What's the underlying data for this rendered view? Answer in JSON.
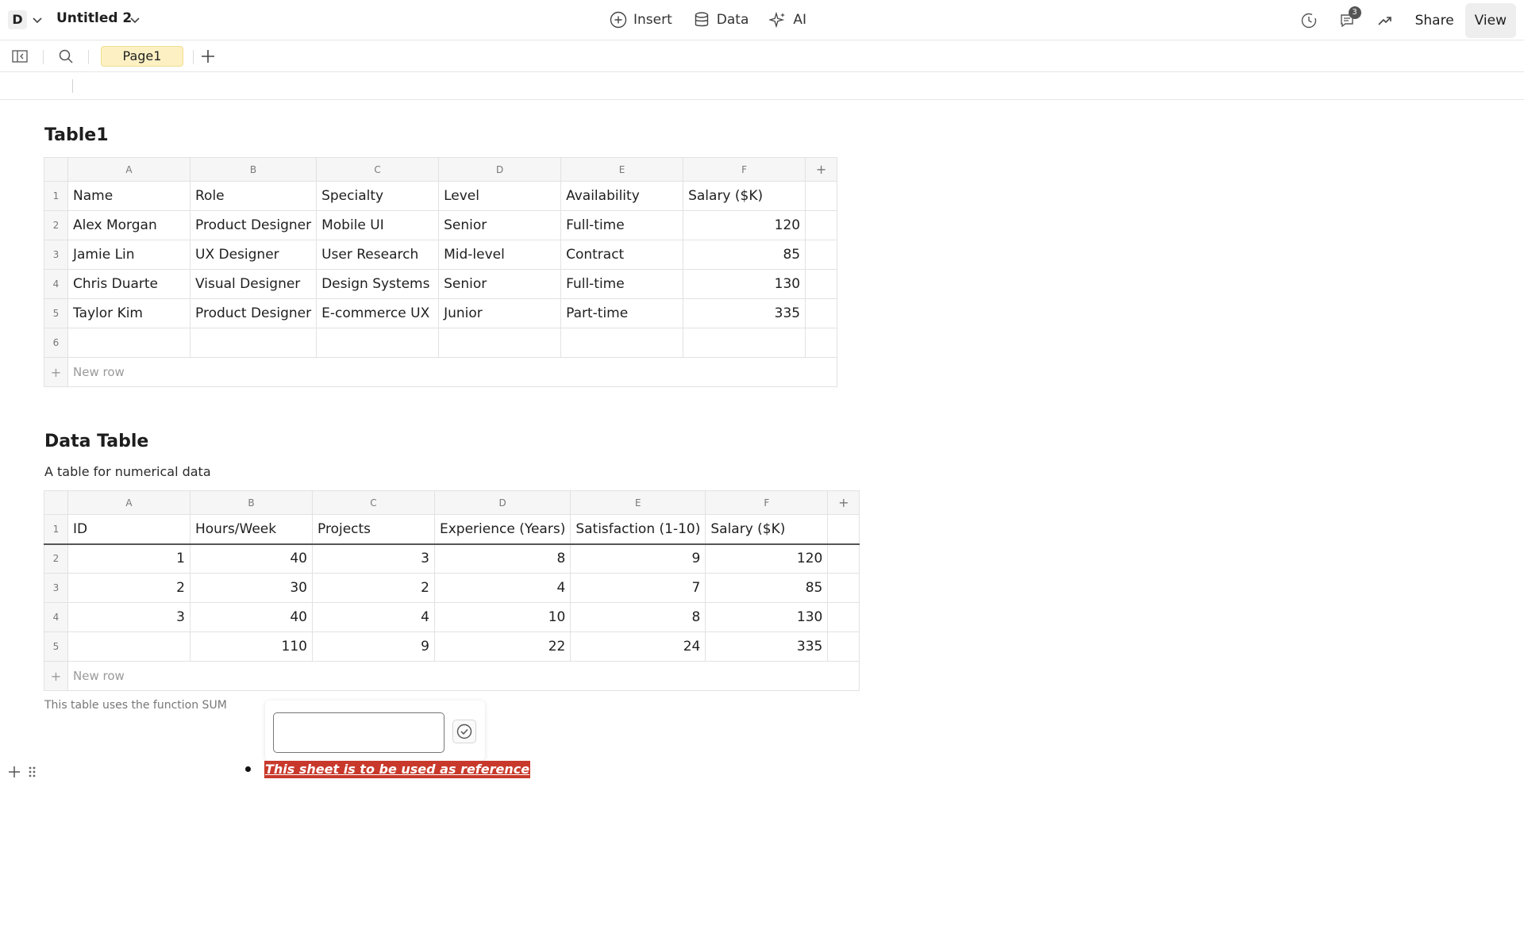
{
  "header": {
    "workspace_initial": "D",
    "doc_title": "Untitled 2",
    "actions": {
      "insert": "Insert",
      "data": "Data",
      "ai": "AI"
    },
    "comments_count": "3",
    "share_label": "Share",
    "view_label": "View"
  },
  "pagebar": {
    "page_tab": "Page1"
  },
  "table1": {
    "title": "Table1",
    "columns": [
      "A",
      "B",
      "C",
      "D",
      "E",
      "F"
    ],
    "add_column": "+",
    "rows": [
      {
        "n": "1",
        "cells": [
          "Name",
          "Role",
          "Specialty",
          "Level",
          "Availability",
          "Salary ($K)"
        ]
      },
      {
        "n": "2",
        "cells": [
          "Alex Morgan",
          "Product Designer",
          "Mobile UI",
          "Senior",
          "Full-time",
          "120"
        ]
      },
      {
        "n": "3",
        "cells": [
          "Jamie Lin",
          "UX Designer",
          "User Research",
          "Mid-level",
          "Contract",
          "85"
        ]
      },
      {
        "n": "4",
        "cells": [
          "Chris Duarte",
          "Visual Designer",
          "Design Systems",
          "Senior",
          "Full-time",
          "130"
        ]
      },
      {
        "n": "5",
        "cells": [
          "Taylor Kim",
          "Product Designer",
          "E-commerce UX",
          "Junior",
          "Part-time",
          "335"
        ]
      },
      {
        "n": "6",
        "cells": [
          "",
          "",
          "",
          "",
          "",
          ""
        ]
      }
    ],
    "new_row_plus": "+",
    "new_row_label": "New row"
  },
  "table2": {
    "title": "Data Table",
    "description": "A table for numerical data",
    "columns": [
      "A",
      "B",
      "C",
      "D",
      "E",
      "F"
    ],
    "add_column": "+",
    "rows": [
      {
        "n": "1",
        "cells": [
          "ID",
          "Hours/Week",
          "Projects",
          "Experience (Years)",
          "Satisfaction (1-10)",
          "Salary ($K)"
        ]
      },
      {
        "n": "2",
        "cells": [
          "1",
          "40",
          "3",
          "8",
          "9",
          "120"
        ]
      },
      {
        "n": "3",
        "cells": [
          "2",
          "30",
          "2",
          "4",
          "7",
          "85"
        ]
      },
      {
        "n": "4",
        "cells": [
          "3",
          "40",
          "4",
          "10",
          "8",
          "130"
        ]
      },
      {
        "n": "5",
        "cells": [
          "",
          "110",
          "9",
          "22",
          "24",
          "335"
        ]
      }
    ],
    "new_row_plus": "+",
    "new_row_label": "New row",
    "note": "This table uses the function SUM"
  },
  "popover": {
    "input_value": ""
  },
  "bullet": {
    "text": "This sheet is to be used as reference"
  }
}
